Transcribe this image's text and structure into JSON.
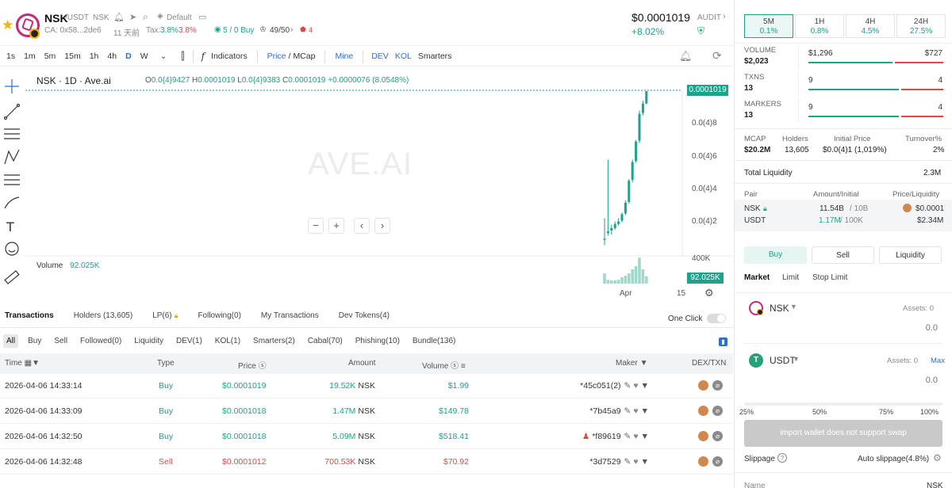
{
  "token": {
    "symbol": "NSK",
    "quote": "/USDT",
    "ticker": "NSK",
    "default_label": "Default",
    "ca": "CA: 0x58...2de6",
    "age": "11 天前",
    "tax_label": "Tax:",
    "tax_buy": "3.8%",
    "tax_sell": "3.8%",
    "buysell": "5 / 0 Buy",
    "holders_frac": "49/50",
    "alerts": "4",
    "price": "$0.0001019",
    "change": "+8.02%",
    "audit": "AUDIT"
  },
  "timeframes": [
    "1s",
    "1m",
    "5m",
    "15m",
    "1h",
    "4h",
    "D",
    "W"
  ],
  "active_timeframe": "D",
  "toolbar": {
    "indicators": "Indicators",
    "price": "Price",
    "mcap": "MCap",
    "mine": "Mine",
    "dev": "DEV",
    "kol": "KOL",
    "smarters": "Smarters"
  },
  "chart_data": {
    "type": "candlestick",
    "title": "NSK · 1D · Ave.ai",
    "ohlc": {
      "o": "0.0{4}9427",
      "h": "0.0001019",
      "l": "0.0{4}9383",
      "c": "0.0001019",
      "chg": "+0.0000076 (8.0548%)"
    },
    "labels": {
      "o": "O",
      "h": "H",
      "l": "L",
      "c": "C"
    },
    "watermark": "AVE.AI",
    "current_price_label": "0.0001019",
    "y_ticks": [
      "0.0(4)8",
      "0.0(4)6",
      "0.0(4)4",
      "0.0(4)2"
    ],
    "volume_axis_label": "400K",
    "volume_label": "Volume",
    "volume_value": "92.025K",
    "x_ticks": [
      "Apr",
      "15"
    ],
    "candles": [
      {
        "o": 1.08e-05,
        "h": 2.4e-05,
        "l": 7.5e-06,
        "c": 1.15e-05
      },
      {
        "o": 1.5e-05,
        "h": 6e-05,
        "l": 1.35e-05,
        "c": 1.6e-05
      },
      {
        "o": 1.65e-05,
        "h": 2e-05,
        "l": 1.4e-05,
        "c": 1.8e-05
      },
      {
        "o": 1.8e-05,
        "h": 2.2e-05,
        "l": 1.7e-05,
        "c": 2.05e-05
      },
      {
        "o": 2.05e-05,
        "h": 2.4e-05,
        "l": 1.95e-05,
        "c": 2.2e-05
      },
      {
        "o": 2.25e-05,
        "h": 2.75e-05,
        "l": 2.15e-05,
        "c": 2.65e-05
      },
      {
        "o": 2.7e-05,
        "h": 3.5e-05,
        "l": 2.6e-05,
        "c": 3.35e-05
      },
      {
        "o": 3.4e-05,
        "h": 4.8e-05,
        "l": 3.3e-05,
        "c": 4.7e-05
      },
      {
        "o": 4.75e-05,
        "h": 6e-05,
        "l": 4.6e-05,
        "c": 5.85e-05
      },
      {
        "o": 5.9e-05,
        "h": 7.2e-05,
        "l": 5.8e-05,
        "c": 7.1e-05
      },
      {
        "o": 7.15e-05,
        "h": 9e-05,
        "l": 7e-05,
        "c": 8.8e-05
      },
      {
        "o": 8.85e-05,
        "h": 9.6e-05,
        "l": 8.7e-05,
        "c": 9.43e-05
      },
      {
        "o": 9.43e-05,
        "h": 0.0001019,
        "l": 9.38e-05,
        "c": 0.0001019
      }
    ],
    "volumes": [
      0.32,
      0.12,
      0.1,
      0.1,
      0.12,
      0.2,
      0.25,
      0.32,
      0.45,
      0.55,
      0.82,
      0.45,
      0.23
    ],
    "ylim": [
      0,
      0.0001019
    ]
  },
  "chart_nav": {
    "zoom_out": "−",
    "zoom_in": "+",
    "left": "‹",
    "right": "›"
  },
  "tabs": [
    "Transactions",
    "Holders (13,605)",
    "LP(6)",
    "Following(0)",
    "My Transactions",
    "Dev Tokens(4)"
  ],
  "one_click": "One Click",
  "filters": [
    "All",
    "Buy",
    "Sell",
    "Followed(0)",
    "Liquidity",
    "DEV(1)",
    "KOL(1)",
    "Smarters(2)",
    "Cabal(70)",
    "Phishing(10)",
    "Bundle(136)"
  ],
  "table": {
    "headers": {
      "time": "Time",
      "type": "Type",
      "price": "Price",
      "amount": "Amount",
      "volume": "Volume",
      "maker": "Maker",
      "dex": "DEX/TXN"
    },
    "rows": [
      {
        "time": "2026-04-06 14:33:14",
        "type": "Buy",
        "price": "$0.0001019",
        "amount": "19.52K",
        "unit": "NSK",
        "volume": "$1.99",
        "maker": "*45c051(2)"
      },
      {
        "time": "2026-04-06 14:33:09",
        "type": "Buy",
        "price": "$0.0001018",
        "amount": "1.47M",
        "unit": "NSK",
        "volume": "$149.78",
        "maker": "*7b45a9"
      },
      {
        "time": "2026-04-06 14:32:50",
        "type": "Buy",
        "price": "$0.0001018",
        "amount": "5.09M",
        "unit": "NSK",
        "volume": "$518.41",
        "maker": "*f89619"
      },
      {
        "time": "2026-04-06 14:32:48",
        "type": "Sell",
        "price": "$0.0001012",
        "amount": "700.53K",
        "unit": "NSK",
        "volume": "$70.92",
        "maker": "*3d7529"
      }
    ]
  },
  "period_stats": [
    {
      "label": "5M",
      "value": "0.1%"
    },
    {
      "label": "1H",
      "value": "0.8%"
    },
    {
      "label": "4H",
      "value": "4.5%"
    },
    {
      "label": "24H",
      "value": "27.5%"
    }
  ],
  "active_period": 0,
  "flow": {
    "volume": {
      "label": "VOLUME",
      "total": "$2,023",
      "buy": "$1,296",
      "sell": "$727",
      "buy_frac": 0.64
    },
    "txns": {
      "label": "TXNS",
      "total": "13",
      "buy": "9",
      "sell": "4",
      "buy_frac": 0.69
    },
    "makers": {
      "label": "MARKERS",
      "total": "13",
      "buy": "9",
      "sell": "4",
      "buy_frac": 0.69
    }
  },
  "metrics": {
    "mcap_label": "MCAP",
    "mcap": "$20.2M",
    "holders_label": "Holders",
    "holders": "13,605",
    "initial_label": "Initial Price",
    "initial": "$0.0(4)1 (1,019%)",
    "turnover_label": "Turnover%",
    "turnover": "2%",
    "liq_label": "Total Liquidity",
    "liq": "2.3M"
  },
  "pair": {
    "headers": {
      "pair": "Pair",
      "amount": "Amount/Initial",
      "price": "Price/Liquidity"
    },
    "base": "NSK",
    "quote": "USDT",
    "base_amount": "11.54B",
    "base_initial": "/ 10B",
    "quote_amount": "1.17M",
    "quote_initial": "/ 100K",
    "price": "$0.0001",
    "liquidity": "$2.34M"
  },
  "trade": {
    "modes": [
      "Buy",
      "Sell",
      "Liquidity"
    ],
    "order_types": [
      "Market",
      "Limit",
      "Stop Limit"
    ],
    "from": {
      "symbol": "NSK",
      "assets": "Assets: 0",
      "placeholder": "0.0"
    },
    "to": {
      "symbol": "USDT",
      "assets": "Assets: 0",
      "max": "Max",
      "placeholder": "0.0"
    },
    "pcts": [
      "25%",
      "50%",
      "75%",
      "100%"
    ],
    "submit": "import wallet does not support swap",
    "slippage_label": "Slippage",
    "slippage_value": "Auto slippage(4.8%)",
    "name_label": "Name",
    "name_value": "NSK"
  },
  "colors": {
    "up": "#1aa48c",
    "down": "#e04848",
    "accent": "#2b6fd6"
  }
}
